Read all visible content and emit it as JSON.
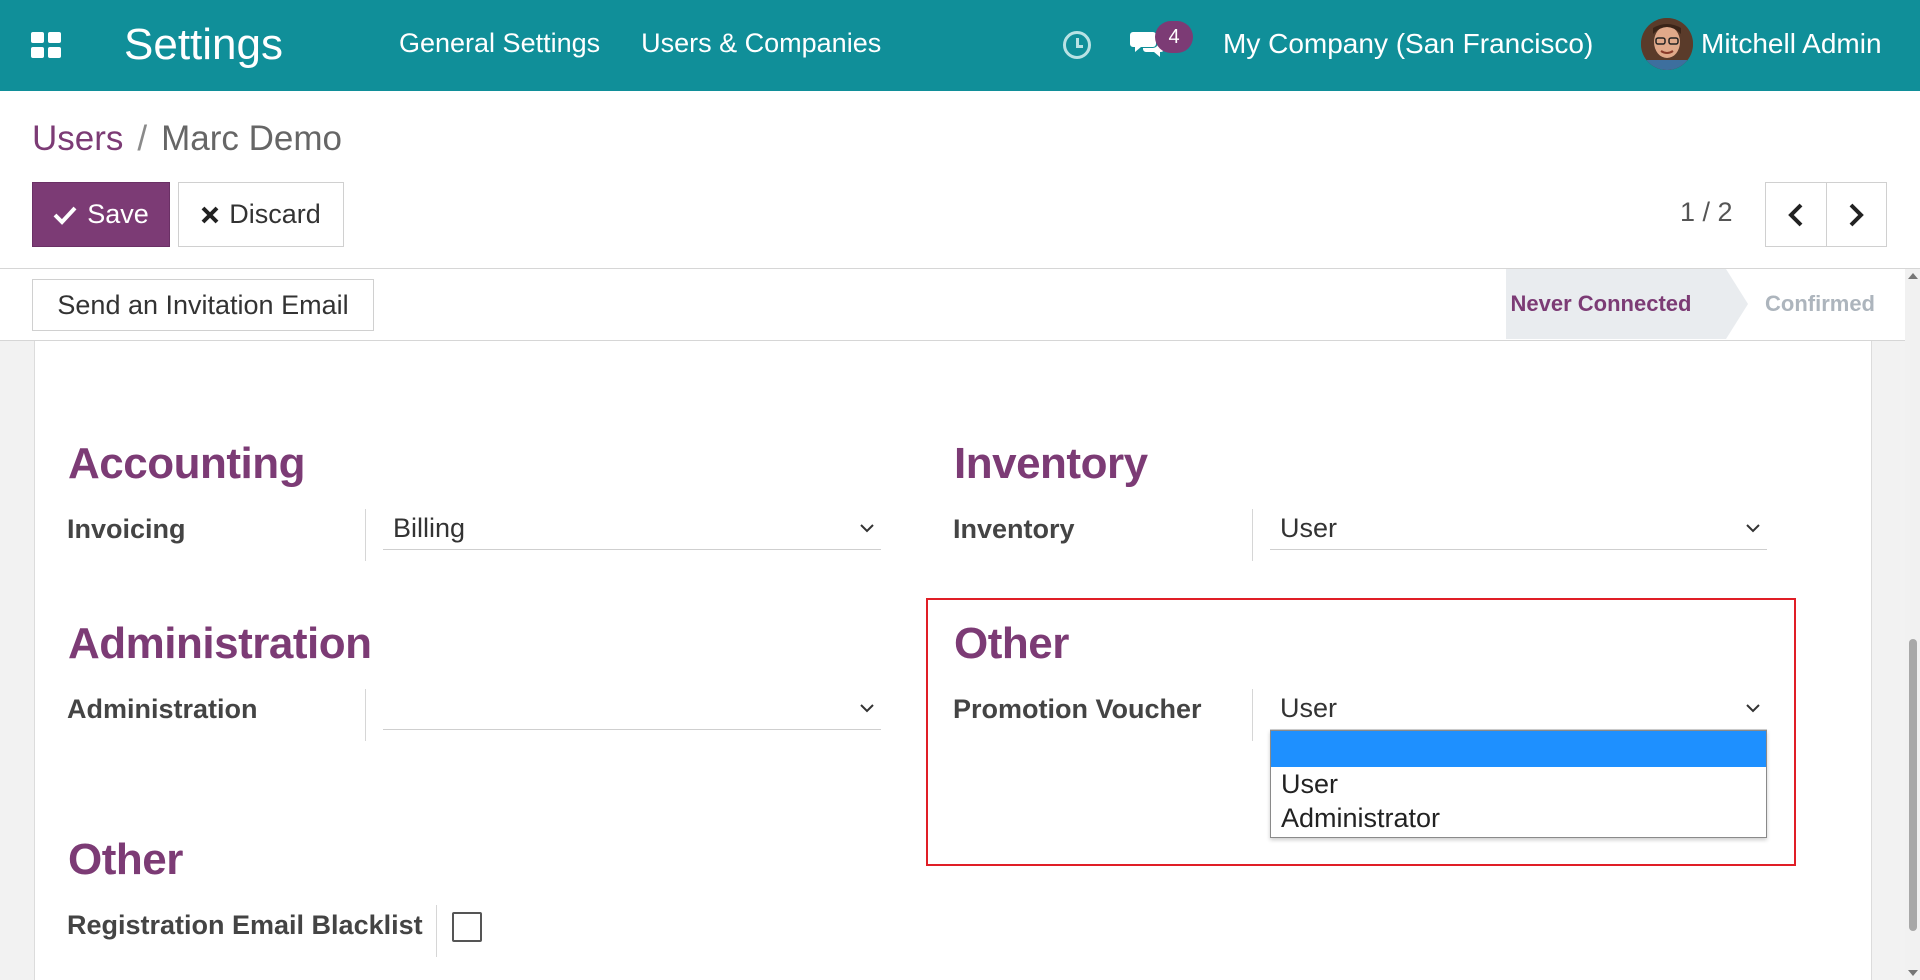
{
  "navbar": {
    "app_title": "Settings",
    "menu": [
      "General Settings",
      "Users & Companies"
    ],
    "chat_count": "4",
    "company": "My Company (San Francisco)",
    "user_name": "Mitchell Admin"
  },
  "breadcrumb": {
    "parent": "Users",
    "separator": "/",
    "current": "Marc Demo"
  },
  "toolbar": {
    "save_label": "Save",
    "discard_label": "Discard"
  },
  "pager": {
    "value": "1 / 2"
  },
  "statusbar": {
    "invite_label": "Send an Invitation Email",
    "stages": [
      "Never Connected",
      "Confirmed"
    ],
    "active_stage": "Never Connected"
  },
  "form": {
    "accounting": {
      "title": "Accounting",
      "field_label": "Invoicing",
      "value": "Billing"
    },
    "inventory": {
      "title": "Inventory",
      "field_label": "Inventory",
      "value": "User"
    },
    "administration": {
      "title": "Administration",
      "field_label": "Administration",
      "value": ""
    },
    "other_right": {
      "title": "Other",
      "field_label": "Promotion Voucher",
      "value": "User",
      "options": [
        "",
        "User",
        "Administrator"
      ],
      "highlighted_option": ""
    },
    "other_left": {
      "title": "Other",
      "field_label": "Registration Email Blacklist",
      "checked": false
    }
  },
  "colors": {
    "navbar": "#108f99",
    "brand": "#7c3b75",
    "highlight_border": "#e01e26",
    "option_selected": "#1e90ff"
  }
}
